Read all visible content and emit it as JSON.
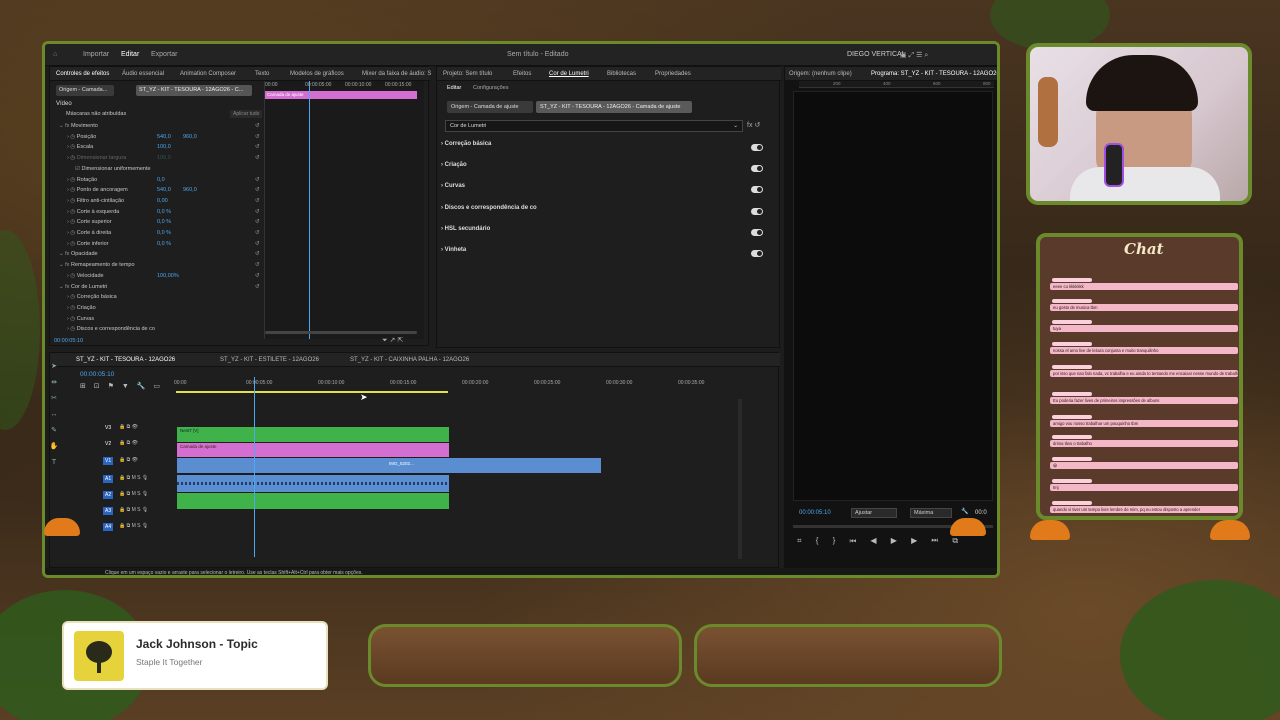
{
  "editor": {
    "menu": [
      "Importar",
      "Editar",
      "Exportar"
    ],
    "doc_title": "Sem título - Editado",
    "workspace": "DIEGO VERTICAL",
    "left_tabs": [
      "Controles de efeitos",
      "Áudio essencial",
      "Animation Composer",
      "Texto",
      "Modelos de gráficos",
      "Mixer da faixa de áudio: S"
    ],
    "source_chip": "Origem - Camada...",
    "clip_chip": "ST_YZ - KIT - TESOURA - 12AGO26 - C...",
    "ruler_times": [
      "00:00",
      "00:00:05:00",
      "00:00:10:00",
      "00:00:15:00"
    ],
    "clip_bar_label": "Camada de ajuste",
    "video_header": "Vídeo",
    "masks": "Máscaras não atribuídas",
    "apply_all": "Aplicar tudo",
    "effects": [
      {
        "label": "Movimento",
        "indent": 1,
        "fx": true
      },
      {
        "label": "Posição",
        "indent": 3,
        "v1": "540,0",
        "v2": "960,0"
      },
      {
        "label": "Escala",
        "indent": 3,
        "v1": "100,0"
      },
      {
        "label": "Dimensionar largura",
        "indent": 3,
        "v1": "100,0",
        "dim": true
      },
      {
        "label": "Dimensionar uniformemente",
        "indent": 5,
        "check": true
      },
      {
        "label": "Rotação",
        "indent": 3,
        "v1": "0,0"
      },
      {
        "label": "Ponto de ancoragem",
        "indent": 3,
        "v1": "540,0",
        "v2": "960,0"
      },
      {
        "label": "Filtro anti-cintilação",
        "indent": 3,
        "v1": "0,00"
      },
      {
        "label": "Corte à esquerda",
        "indent": 3,
        "v1": "0,0 %"
      },
      {
        "label": "Corte superior",
        "indent": 3,
        "v1": "0,0 %"
      },
      {
        "label": "Corte à direita",
        "indent": 3,
        "v1": "0,0 %"
      },
      {
        "label": "Corte inferior",
        "indent": 3,
        "v1": "0,0 %"
      },
      {
        "label": "Opacidade",
        "indent": 1,
        "fx": true
      },
      {
        "label": "Remapeamento de tempo",
        "indent": 1,
        "fx": true
      },
      {
        "label": "Velocidade",
        "indent": 3,
        "v1": "100,00%"
      },
      {
        "label": "Cor de Lumetri",
        "indent": 1,
        "fx": true
      },
      {
        "label": "Correção básica",
        "indent": 3
      },
      {
        "label": "Criação",
        "indent": 3
      },
      {
        "label": "Curvas",
        "indent": 3
      },
      {
        "label": "Discos e correspondência de co",
        "indent": 3
      }
    ],
    "ec_timecode": "00:00:05:10",
    "center_tabs": [
      "Projeto: Sem título",
      "Efeitos",
      "Cor de Lumetri",
      "Bibliotecas",
      "Propriedades"
    ],
    "lumetri_subtabs": [
      "Editar",
      "Configurações"
    ],
    "lumetri_source": "Origem - Camada de ajuste",
    "lumetri_clip": "ST_YZ - KIT - TESOURA - 12AGO26 - Camada de ajuste",
    "lumetri_select": "Cor de Lumetri",
    "lumetri_sections": [
      "Correção básica",
      "Criação",
      "Curvas",
      "Discos e correspondência de co",
      "HSL secundário",
      "Vinheta"
    ],
    "source_monitor": "Origem: (nenhum clipe)",
    "program_monitor": "Programa: ST_YZ - KIT - TESOURA - 12AGO26",
    "program_ruler": [
      "200",
      "400",
      "600",
      "800"
    ],
    "program_timecode": "00:00:05:10",
    "fit_select": "Ajustar",
    "quality_select": "Máxima",
    "program_end": "00:0",
    "sequence_tabs": [
      "ST_YZ - KIT - TESOURA - 12AGO26",
      "ST_YZ - KIT - ESTILETE - 12AGO26",
      "ST_YZ - KIT - CAIXINHA PALHA - 12AGO26"
    ],
    "seq_timecode": "00:00:05:10",
    "timeline_ruler": [
      "00:00",
      "00:00:05:00",
      "00:00:10:00",
      "00:00:15:00",
      "00:00:20:00",
      "00:00:25:00",
      "00:00:30:00",
      "00:00:35:00"
    ],
    "tracks": [
      "V3",
      "V2",
      "V1",
      "A1",
      "A2",
      "A3",
      "A4"
    ],
    "clip_v3": "Nest7 [V]",
    "clip_v2": "Camada de ajuste",
    "clip_v1": "IMG_5202...",
    "status_bar": "Clique em um espaço vazio e arraste para selecionar o letreiro. Use as teclas Shift+Alt+Ctrl para obter mais opções."
  },
  "chat": {
    "title": "Chat",
    "messages": [
      "eeee cu kkkkkkk",
      "eu gosto de musica tbm",
      "tuya",
      "nossa el amo live de leitura conjunta e muito tranquilinho",
      "por isso que nao falo nada, vc trabalha e eu ainda to tentando me encaixar nesse mundo de trabalhar no pc em casa",
      "Eu poderia fazer lives de primeiros impressões de albuns",
      "amigo vou nosso trabalhar um pouquinho tbm",
      "drima tlwo o trabalho",
      "😀",
      "tmj",
      "quando vi tiver um tempo livre lembre de mim, pq eu estou disposto a aprender"
    ]
  },
  "now_playing": {
    "artist": "Jack Johnson - Topic",
    "track": "Staple It Together"
  },
  "colors": {
    "accent": "#6b8a2a",
    "clip_green": "#3fb24a",
    "clip_pink": "#d36fd1",
    "clip_blue": "#5a8ed0",
    "playhead": "#4ca8f0"
  }
}
